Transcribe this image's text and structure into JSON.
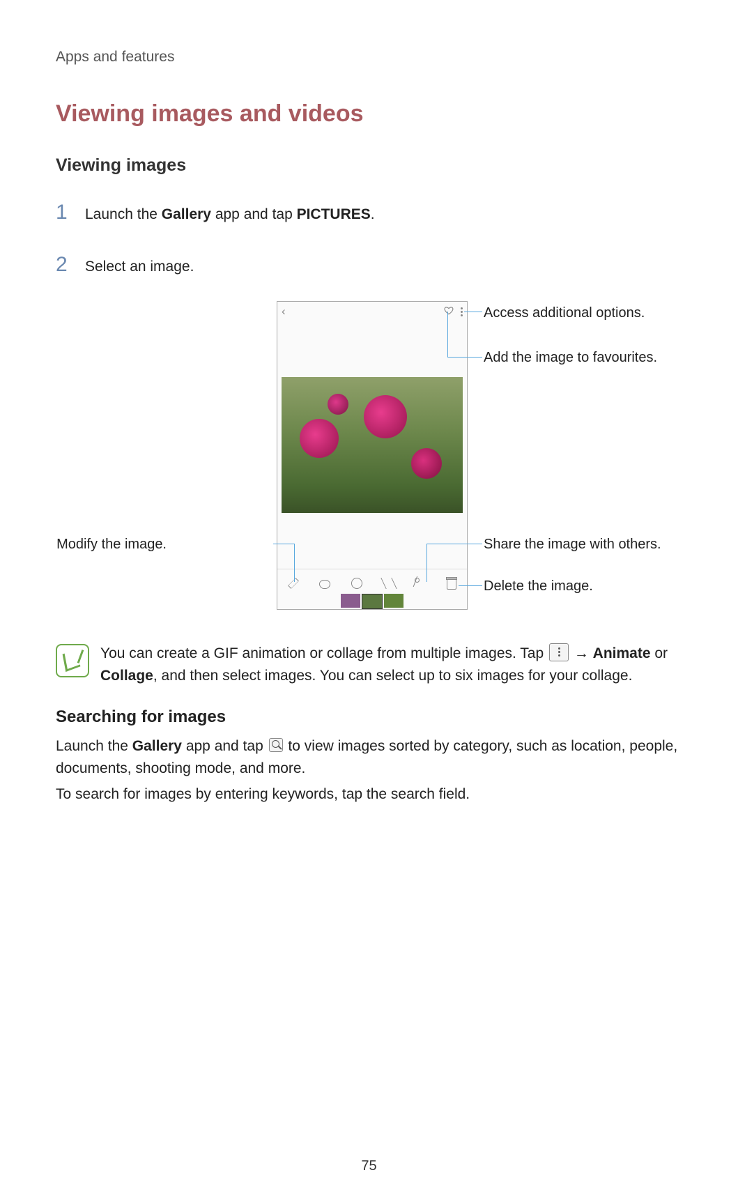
{
  "header": {
    "breadcrumb": "Apps and features"
  },
  "title": "Viewing images and videos",
  "sections": {
    "viewing_images": {
      "heading": "Viewing images",
      "steps": [
        {
          "num": "1",
          "pre": "Launch the ",
          "b1": "Gallery",
          "mid": " app and tap ",
          "b2": "PICTURES",
          "post": "."
        },
        {
          "num": "2",
          "text": "Select an image."
        }
      ]
    },
    "callouts": {
      "options": "Access additional options.",
      "favourite": "Add the image to favourites.",
      "share": "Share the image with others.",
      "delete": "Delete the image.",
      "modify": "Modify the image."
    },
    "tip": {
      "pre": "You can create a GIF animation or collage from multiple images. Tap ",
      "arrow": " → ",
      "b1": "Animate",
      "mid": " or ",
      "b2": "Collage",
      "post": ", and then select images. You can select up to six images for your collage."
    },
    "searching": {
      "heading": "Searching for images",
      "p1_pre": "Launch the ",
      "p1_b": "Gallery",
      "p1_mid": " app and tap ",
      "p1_post": " to view images sorted by category, such as location, people, documents, shooting mode, and more.",
      "p2": "To search for images by entering keywords, tap the search field."
    }
  },
  "page_number": "75"
}
